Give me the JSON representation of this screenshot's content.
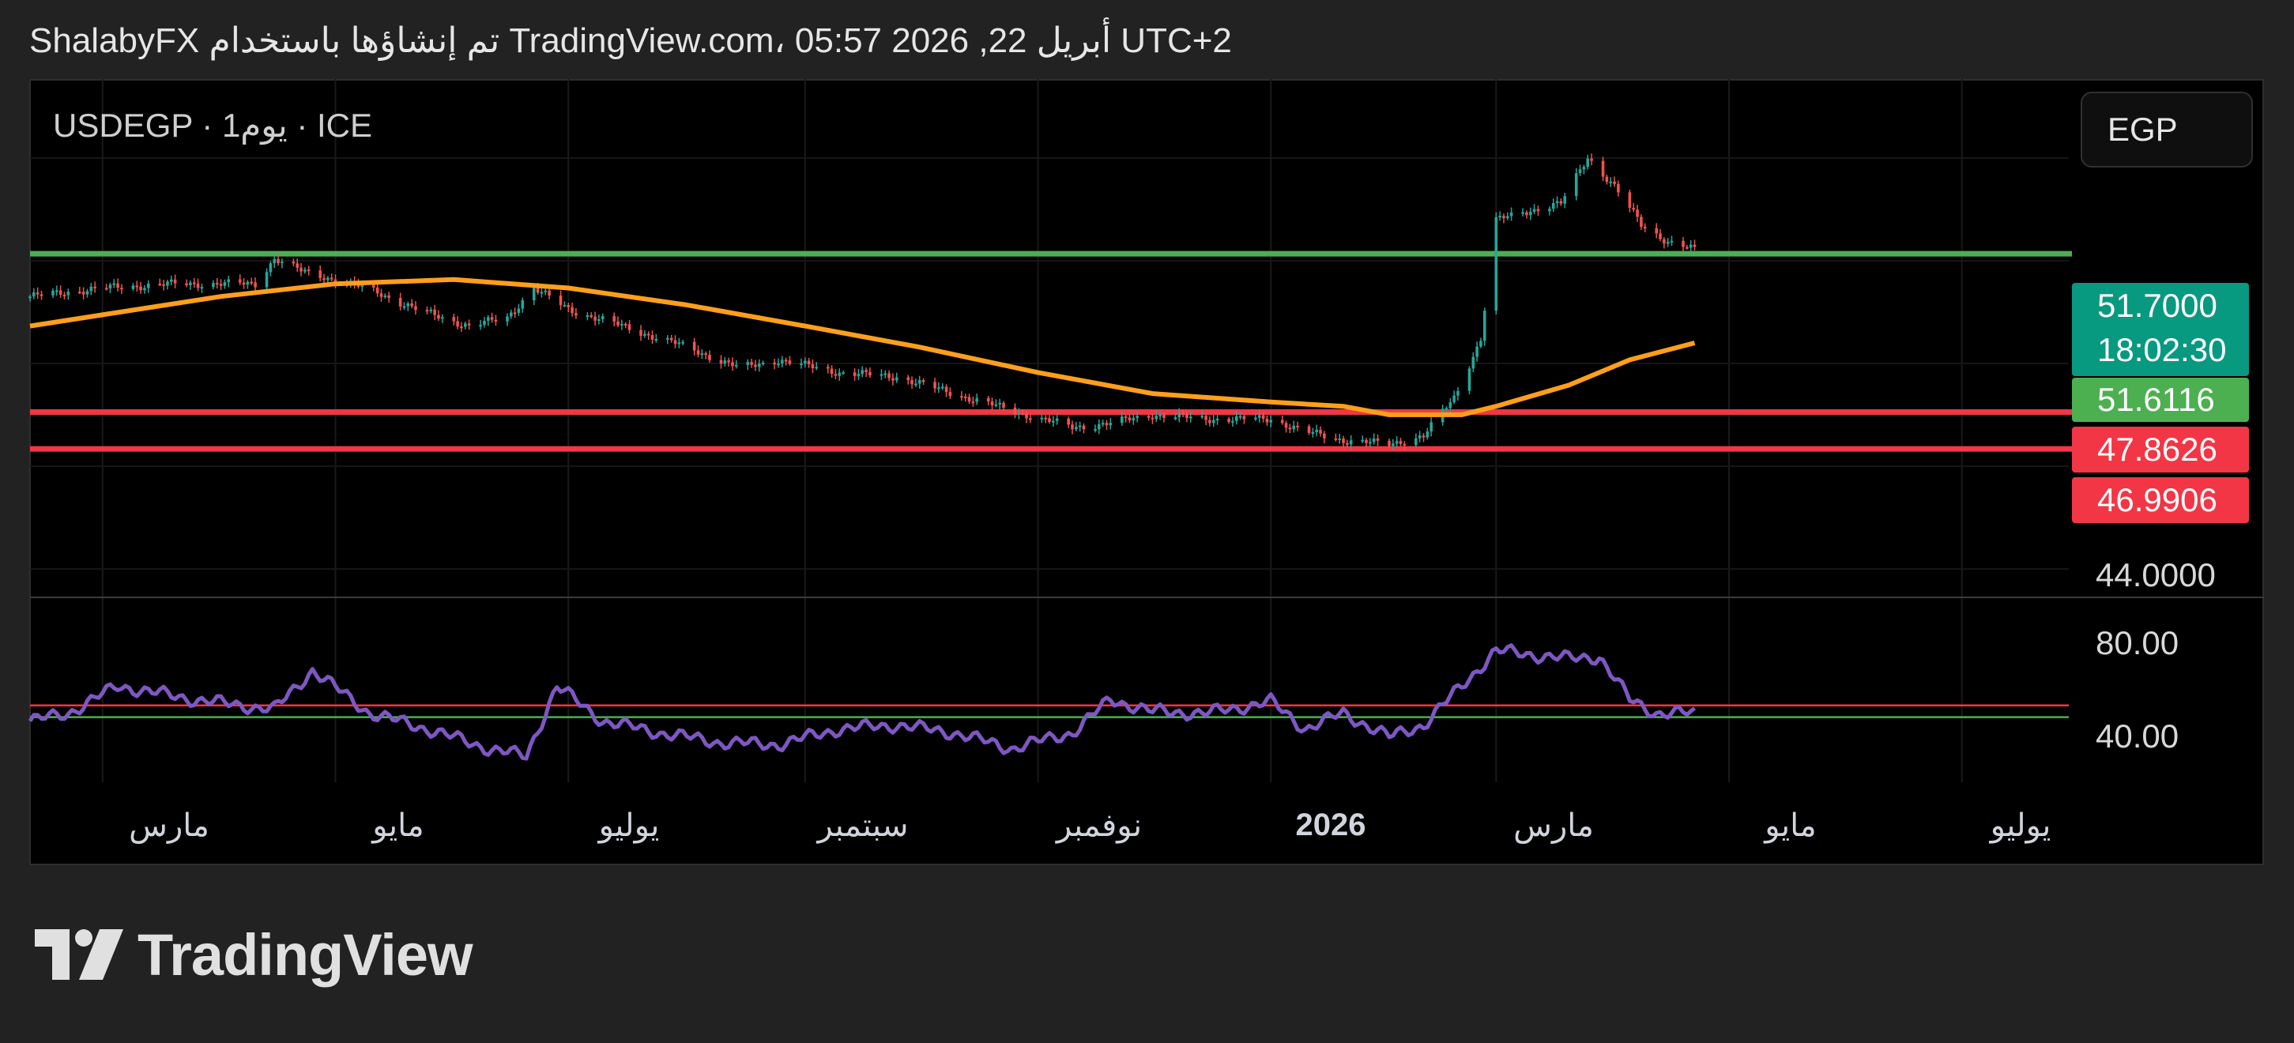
{
  "header": {
    "caption": "ShalabyFX تم إنشاؤها باستخدام TradingView.com، 05:57 2026 ,22 أبريل UTC+2"
  },
  "symbol": {
    "label": "USDEGP · 1يوم · ICE"
  },
  "currency_button": {
    "label": "EGP"
  },
  "price_tags": {
    "last_price": "51.7000",
    "countdown": "18:02:30",
    "level_green": "51.6116",
    "level_red_1": "47.8626",
    "level_red_2": "46.9906",
    "scale_bottom": "44.0000"
  },
  "rsi_scale": {
    "upper": "80.00",
    "lower": "40.00"
  },
  "x_labels": [
    "مارس",
    "مايو",
    "يوليو",
    "سبتمبر",
    "نوفمبر",
    "2026",
    "مارس",
    "مايو",
    "يوليو"
  ],
  "brand": {
    "name": "TradingView"
  },
  "colors": {
    "up": "#26a69a",
    "down": "#ef5350",
    "ma": "#ff9f1a",
    "rsi": "#7e57c2",
    "level_green": "#4caf50",
    "level_red": "#f23645"
  },
  "chart_data": {
    "type": "candlestick",
    "symbol": "USDEGP",
    "timeframe": "1D",
    "y_range": [
      44.0,
      55.0
    ],
    "horizontal_levels": [
      {
        "value": 51.6116,
        "color": "green"
      },
      {
        "value": 47.8626,
        "color": "red"
      },
      {
        "value": 46.9906,
        "color": "red"
      }
    ],
    "close_series": {
      "x": [
        "2025-02-10",
        "2025-03-01",
        "2025-03-20",
        "2025-04-10",
        "2025-04-15",
        "2025-04-22",
        "2025-05-01",
        "2025-05-12",
        "2025-05-22",
        "2025-06-05",
        "2025-06-15",
        "2025-06-22",
        "2025-07-01",
        "2025-07-15",
        "2025-08-01",
        "2025-08-15",
        "2025-08-25",
        "2025-09-10",
        "2025-09-25",
        "2025-10-10",
        "2025-10-25",
        "2025-11-10",
        "2025-11-20",
        "2025-12-01",
        "2025-12-15",
        "2026-01-01",
        "2026-01-10",
        "2026-01-20",
        "2026-02-01",
        "2026-02-10",
        "2026-02-18",
        "2026-02-25",
        "2026-03-01",
        "2026-03-08",
        "2026-03-18",
        "2026-03-25",
        "2026-04-01",
        "2026-04-08",
        "2026-04-15",
        "2026-04-22"
      ],
      "y": [
        50.6,
        50.8,
        50.9,
        50.9,
        51.5,
        51.2,
        51.0,
        50.7,
        50.3,
        49.9,
        50.1,
        50.8,
        50.3,
        49.9,
        49.4,
        48.9,
        49.1,
        48.8,
        48.7,
        48.3,
        47.9,
        47.5,
        47.6,
        47.8,
        47.7,
        47.7,
        47.4,
        47.2,
        47.1,
        47.3,
        48.2,
        49.6,
        52.4,
        52.6,
        52.8,
        53.9,
        53.2,
        52.3,
        51.9,
        51.7
      ]
    },
    "moving_average": {
      "x": [
        "2025-02-10",
        "2025-04-01",
        "2025-05-01",
        "2025-06-01",
        "2025-07-01",
        "2025-08-01",
        "2025-09-01",
        "2025-10-01",
        "2025-11-01",
        "2025-12-01",
        "2026-01-01",
        "2026-01-20",
        "2026-02-01",
        "2026-02-20",
        "2026-03-01",
        "2026-03-20",
        "2026-04-05",
        "2026-04-22"
      ],
      "y": [
        49.9,
        50.6,
        50.9,
        51.0,
        50.8,
        50.4,
        49.9,
        49.4,
        48.8,
        48.3,
        48.1,
        48.0,
        47.8,
        47.8,
        48.0,
        48.5,
        49.1,
        49.5
      ]
    },
    "rsi": {
      "range": [
        20,
        100
      ],
      "levels": [
        52,
        46
      ],
      "x": [
        "2025-02-10",
        "2025-02-20",
        "2025-03-05",
        "2025-03-25",
        "2025-04-15",
        "2025-04-25",
        "2025-05-10",
        "2025-05-25",
        "2025-06-10",
        "2025-06-20",
        "2025-06-28",
        "2025-07-10",
        "2025-07-25",
        "2025-08-10",
        "2025-08-25",
        "2025-09-10",
        "2025-09-25",
        "2025-10-10",
        "2025-10-25",
        "2025-11-10",
        "2025-11-20",
        "2025-12-01",
        "2025-12-15",
        "2026-01-01",
        "2026-01-10",
        "2026-01-20",
        "2026-02-01",
        "2026-02-10",
        "2026-02-20",
        "2026-03-01",
        "2026-03-10",
        "2026-03-20",
        "2026-03-28",
        "2026-04-05",
        "2026-04-12",
        "2026-04-22"
      ],
      "y": [
        44,
        48,
        62,
        55,
        50,
        70,
        48,
        40,
        30,
        26,
        62,
        44,
        38,
        33,
        32,
        40,
        42,
        38,
        30,
        38,
        55,
        49,
        48,
        54,
        40,
        48,
        36,
        42,
        62,
        80,
        78,
        76,
        77,
        55,
        48,
        48
      ]
    }
  }
}
